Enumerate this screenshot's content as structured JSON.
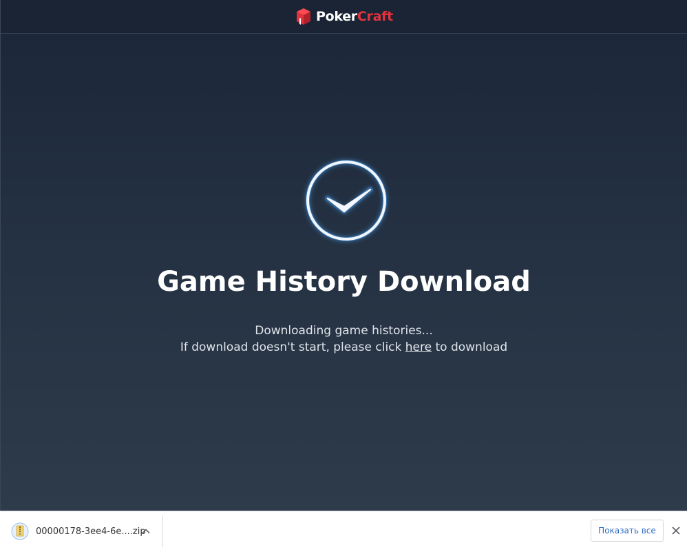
{
  "header": {
    "logo_part1": "Poker",
    "logo_part2": "Craft",
    "logo_icon": "poker-chip-cube-icon",
    "brand_red": "#e2333c"
  },
  "main": {
    "status_icon": "checkmark-circle-icon",
    "title": "Game History Download",
    "line1": "Downloading game histories...",
    "line2_before": "If download doesn't start, please click ",
    "line2_link": "here",
    "line2_after": " to download"
  },
  "download_bar": {
    "file_icon": "zip-file-icon",
    "file_name": "00000178-3ee4-6e....zip",
    "chevron_icon": "chevron-up-icon",
    "show_all_label": "Показать все",
    "close_icon": "close-icon"
  }
}
